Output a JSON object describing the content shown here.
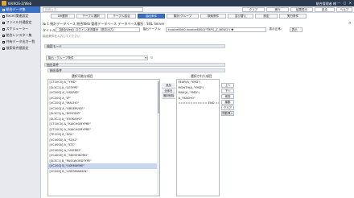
{
  "titlebar": {
    "app": "KAIROS-Z/Web",
    "user": "統合管理者 様"
  },
  "sidebar": {
    "items": [
      {
        "label": "統合データ集"
      },
      {
        "label": "Excel 関連設定"
      },
      {
        "label": "ファイル共通設定"
      },
      {
        "label": "スケジューラー"
      },
      {
        "label": "統合レジスター集"
      },
      {
        "label": "共有データ出力一覧"
      },
      {
        "label": "検索条件値設定"
      }
    ]
  },
  "toolbar": {
    "search_placeholder": "検索入力",
    "buttons": [
      "クリア",
      "実行",
      "結果表示",
      "戻る",
      "ヘルプ"
    ]
  },
  "tabs": [
    "DB選択",
    "テーブル選択",
    "テーブル結合",
    "抽出条件",
    "集計/グループ",
    "検索条件",
    "並び替え",
    "設定",
    "実行条件"
  ],
  "active_tab_index": 3,
  "breadcrumb": "№ 1   統計データベース 統合Web 管理データベース   データベース種別：SQL Server",
  "title_line": {
    "prefix": "タイトル：",
    "title_value": "【統合Web】ログイン状況集計（週次出力）",
    "table_label": "抽出テーブル：",
    "table_value": "Invoice6000.Invoice6000(\"TRPO_Z_NEW1\") ▼",
    "count_label": "表示正常：",
    "count_value": "表示"
  },
  "hint": "抽出条件を入力してください",
  "sections": {
    "search_mode": "検索モード",
    "conditions": "抽出条件",
    "sub_conditions": "抽出条件"
  },
  "select": {
    "value": "抽出・グループ条件",
    "reload": "↻"
  },
  "left_panel": {
    "label": "選択可能な項目",
    "items": [
      "[CT10C0] A_\"YMD\"",
      "[SL3C1] A_\"LOTYPE\"",
      "[VC200] A_\"USERID\"",
      "[VC200] A_\"IP\"",
      "[VC200] A_\"MACHO\"",
      "[VC200] A_\"OBSERVICE\"",
      "[SL3C1] A_\"DOYODO\"",
      "[SL3C1] A_\"SYOKAIYO\"",
      "[CT10C0] A_\"KAICHOMYPRE\"",
      "[CT10C0] A_\"KAICHOMYPRE\"",
      "[TE1C4] A_\"SQL\"",
      "[VC4000] A_\"SQL2\"",
      "[VC4000] A_\"ETC\"",
      "[VC4000] A_\"USERID\"",
      "[VC4000] B_\"SKOSHKORD\"",
      "[SL3C1] B_\"PASSWORDTYPE\"",
      "[VC200] B_\"USRMAYME\"",
      "[VC200] B_\"USERMANSIN\""
    ],
    "selected_index": 16
  },
  "middle_buttons": [
    "追加",
    "全体を",
    "選択削除"
  ],
  "right_panel": {
    "label": "選択された項目",
    "items": [
      "YEAR(A_\"YMD\")",
      "MONTH(A_\"YMD\")",
      "MAX(A_\"YMD\")",
      "A_\"MACHO\"",
      "============ END ====="
    ]
  },
  "side_buttons": [
    "上へ",
    "下へ",
    "削除",
    "編集",
    "クリア",
    "関数挿入"
  ]
}
